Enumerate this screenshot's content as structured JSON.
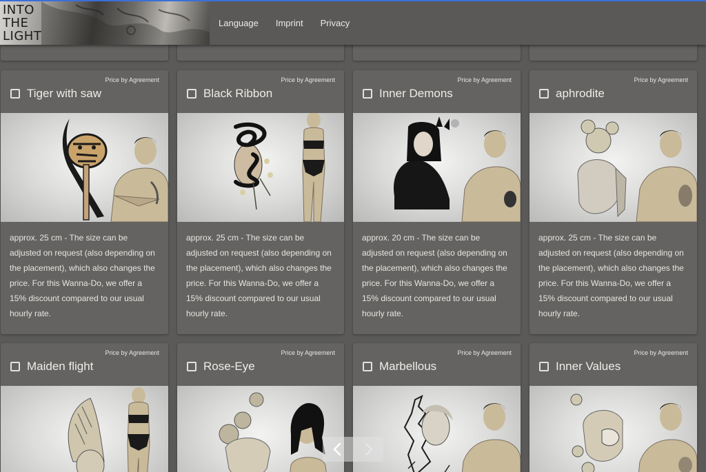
{
  "logo": {
    "line1": "INTO",
    "line2": "THE",
    "line3": "LIGHT"
  },
  "nav": {
    "language": "Language",
    "imprint": "Imprint",
    "privacy": "Privacy"
  },
  "cards": [
    {
      "price": "Price by Agreement",
      "title": "Tiger with saw",
      "desc": "approx. 25 cm - The size can be adjusted on request (also depending on the placement), which also changes the price. For this Wanna-Do, we offer a 15% discount compared to our usual hourly rate."
    },
    {
      "price": "Price by Agreement",
      "title": "Black Ribbon",
      "desc": "approx. 25 cm - The size can be adjusted on request (also depending on the placement), which also changes the price. For this Wanna-Do, we offer a 15% discount compared to our usual hourly rate."
    },
    {
      "price": "Price by Agreement",
      "title": "Inner Demons",
      "desc": "approx. 20 cm - The size can be adjusted on request (also depending on the placement), which also changes the price. For this Wanna-Do, we offer a 15% discount compared to our usual hourly rate."
    },
    {
      "price": "Price by Agreement",
      "title": "aphrodite",
      "desc": "approx. 25 cm - The size can be adjusted on request (also depending on the placement), which also changes the price. For this Wanna-Do, we offer a 15% discount compared to our usual hourly rate."
    },
    {
      "price": "Price by Agreement",
      "title": "Maiden flight",
      "desc": ""
    },
    {
      "price": "Price by Agreement",
      "title": "Rose-Eye",
      "desc": ""
    },
    {
      "price": "Price by Agreement",
      "title": "Marbellous",
      "desc": ""
    },
    {
      "price": "Price by Agreement",
      "title": "Inner Values",
      "desc": ""
    }
  ],
  "carousel": {
    "prev_icon": "chevron-left-icon",
    "next_icon": "chevron-right-icon"
  }
}
